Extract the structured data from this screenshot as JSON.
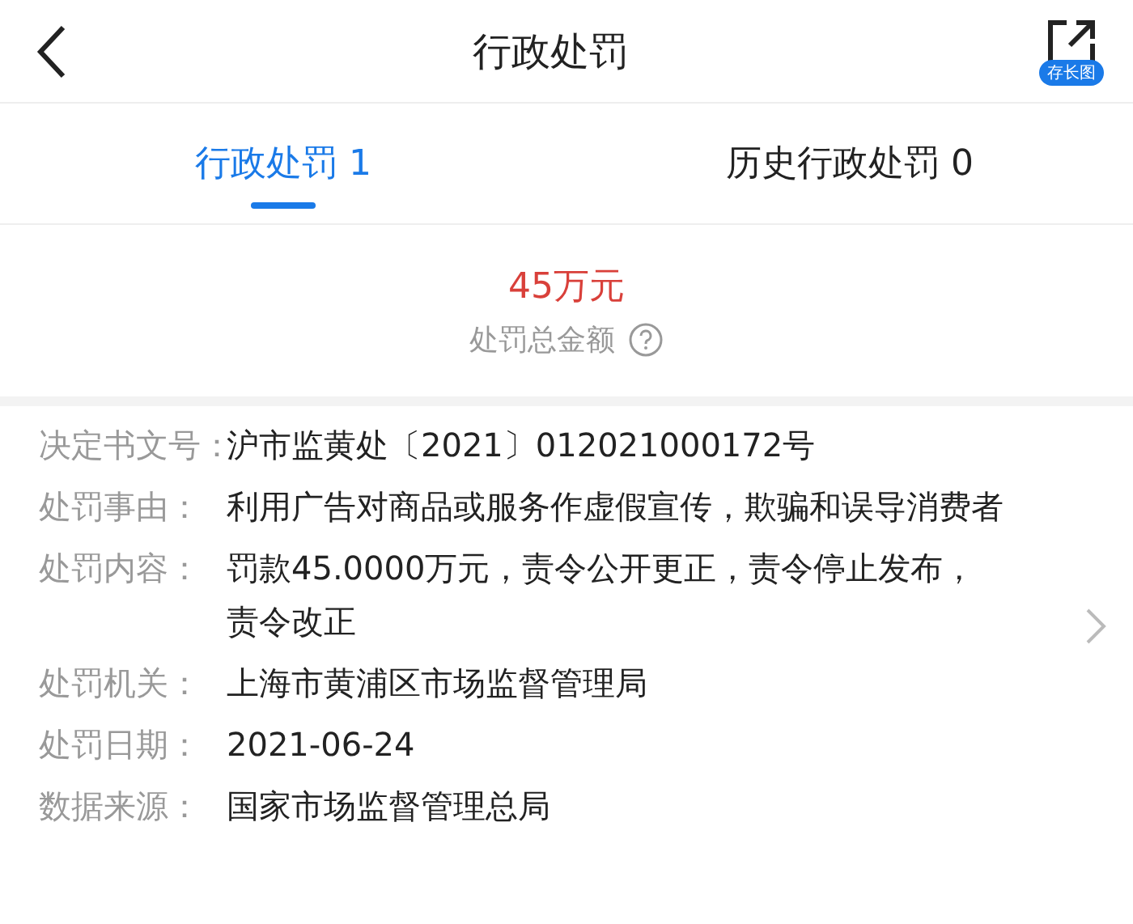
{
  "header": {
    "title": "行政处罚",
    "share_badge": "存长图"
  },
  "tabs": [
    {
      "label": "行政处罚 1",
      "selected": true
    },
    {
      "label": "历史行政处罚 0",
      "selected": false
    }
  ],
  "summary": {
    "amount": "45万元",
    "caption": "处罚总金额"
  },
  "details": [
    {
      "label": "决定书文号：",
      "value": "沪市监黄处〔2021〕012021000172号"
    },
    {
      "label": "处罚事由：",
      "value": "利用广告对商品或服务作虚假宣传，欺骗和误导消费者"
    },
    {
      "label": "处罚内容：",
      "value": "罚款45.0000万元，责令公开更正，责令停止发布，责令改正"
    },
    {
      "label": "处罚机关：",
      "value": "上海市黄浦区市场监督管理局"
    },
    {
      "label": "处罚日期：",
      "value": "2021-06-24"
    },
    {
      "label": "数据来源：",
      "value": "国家市场监督管理总局"
    }
  ]
}
